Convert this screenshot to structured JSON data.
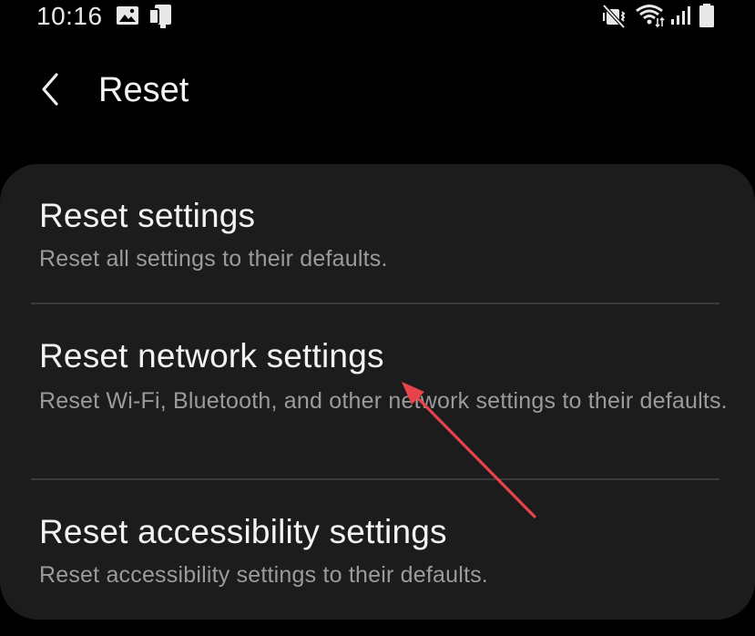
{
  "status_bar": {
    "time": "10:16",
    "icons": [
      "gallery-icon",
      "device-icon",
      "mute-icon",
      "wifi-icon",
      "signal-icon",
      "battery-icon"
    ]
  },
  "app_bar": {
    "back_icon": "chevron-left-icon",
    "title": "Reset"
  },
  "items": [
    {
      "title": "Reset settings",
      "subtitle": "Reset all settings to their defaults."
    },
    {
      "title": "Reset network settings",
      "subtitle": "Reset Wi-Fi, Bluetooth, and other network settings to their defaults."
    },
    {
      "title": "Reset accessibility settings",
      "subtitle": "Reset accessibility settings to their defaults."
    }
  ],
  "colors": {
    "background": "#000000",
    "card": "#1c1c1c",
    "title_text": "#f3f3f3",
    "subtitle_text": "#9b9b9b",
    "divider": "#3a3a3a",
    "annotation_arrow": "#e8434a"
  }
}
